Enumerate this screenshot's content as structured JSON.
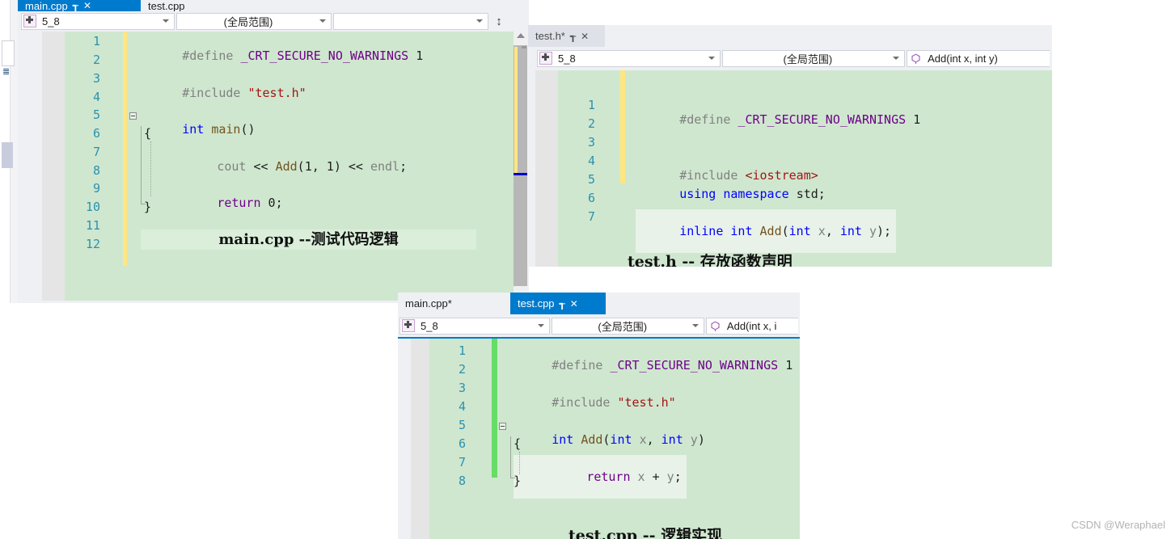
{
  "watermark": "CSDN @Weraphael",
  "windows": [
    {
      "id": "main-cpp-window",
      "tabs": [
        {
          "label": "main.cpp",
          "state": "active",
          "pin": "┱",
          "close": "✕"
        },
        {
          "label": "test.cpp",
          "state": "inactive",
          "pin": "",
          "close": ""
        }
      ],
      "navbar": {
        "project": "5_8",
        "scope": "(全局范围)",
        "member": "",
        "split_icon": "split-window-icon"
      },
      "lines": [
        {
          "n": "1",
          "text": "#define _CRT_SECURE_NO_WARNINGS 1"
        },
        {
          "n": "2",
          "text": ""
        },
        {
          "n": "3",
          "text": "#include \"test.h\""
        },
        {
          "n": "4",
          "text": ""
        },
        {
          "n": "5",
          "text": "int main()"
        },
        {
          "n": "6",
          "text": "{"
        },
        {
          "n": "7",
          "text": "    cout << Add(1, 1) << endl;"
        },
        {
          "n": "8",
          "text": ""
        },
        {
          "n": "9",
          "text": "    return 0;"
        },
        {
          "n": "10",
          "text": "}"
        },
        {
          "n": "11",
          "text": ""
        },
        {
          "n": "12",
          "text": ""
        }
      ],
      "annotation": "main.cpp --测试代码逻辑"
    },
    {
      "id": "test-h-window",
      "tabs": [
        {
          "label": "test.h*",
          "state": "inactive2",
          "pin": "┱",
          "close": "✕"
        }
      ],
      "navbar": {
        "project": "5_8",
        "scope": "(全局范围)",
        "member": "Add(int x, int y)",
        "member_icon": "method-icon"
      },
      "lines": [
        {
          "n": "1",
          "text": "#define _CRT_SECURE_NO_WARNINGS 1"
        },
        {
          "n": "2",
          "text": ""
        },
        {
          "n": "3",
          "text": ""
        },
        {
          "n": "4",
          "text": "#include <iostream>"
        },
        {
          "n": "5",
          "text": "using namespace std;"
        },
        {
          "n": "6",
          "text": ""
        },
        {
          "n": "7",
          "text": "inline int Add(int x, int y);"
        }
      ],
      "annotation": "test.h -- 存放函数声明"
    },
    {
      "id": "test-cpp-window",
      "tabs": [
        {
          "label": "main.cpp*",
          "state": "inactive",
          "pin": "",
          "close": ""
        },
        {
          "label": "test.cpp",
          "state": "active",
          "pin": "┱",
          "close": "✕"
        }
      ],
      "navbar": {
        "project": "5_8",
        "scope": "(全局范围)",
        "member": "Add(int x, i",
        "member_icon": "method-icon"
      },
      "lines": [
        {
          "n": "1",
          "text": "#define _CRT_SECURE_NO_WARNINGS 1"
        },
        {
          "n": "2",
          "text": ""
        },
        {
          "n": "3",
          "text": "#include \"test.h\""
        },
        {
          "n": "4",
          "text": ""
        },
        {
          "n": "5",
          "text": "int Add(int x, int y)"
        },
        {
          "n": "6",
          "text": "{"
        },
        {
          "n": "7",
          "text": "    return x + y;"
        },
        {
          "n": "8",
          "text": "}"
        }
      ],
      "annotation": "test.cpp -- 逻辑实现"
    }
  ],
  "colors": {
    "editor_bg": "#cfe7cf",
    "gutter_bg": "#e5e5e5",
    "active_tab": "#007acc",
    "change_bar_unsaved": "#ffe680",
    "change_bar_saved": "#66dd66",
    "line_number": "#2b91af",
    "keyword": "#0000ff",
    "macro": "#6f008a",
    "string": "#a31515",
    "preprocessor": "#808080"
  }
}
